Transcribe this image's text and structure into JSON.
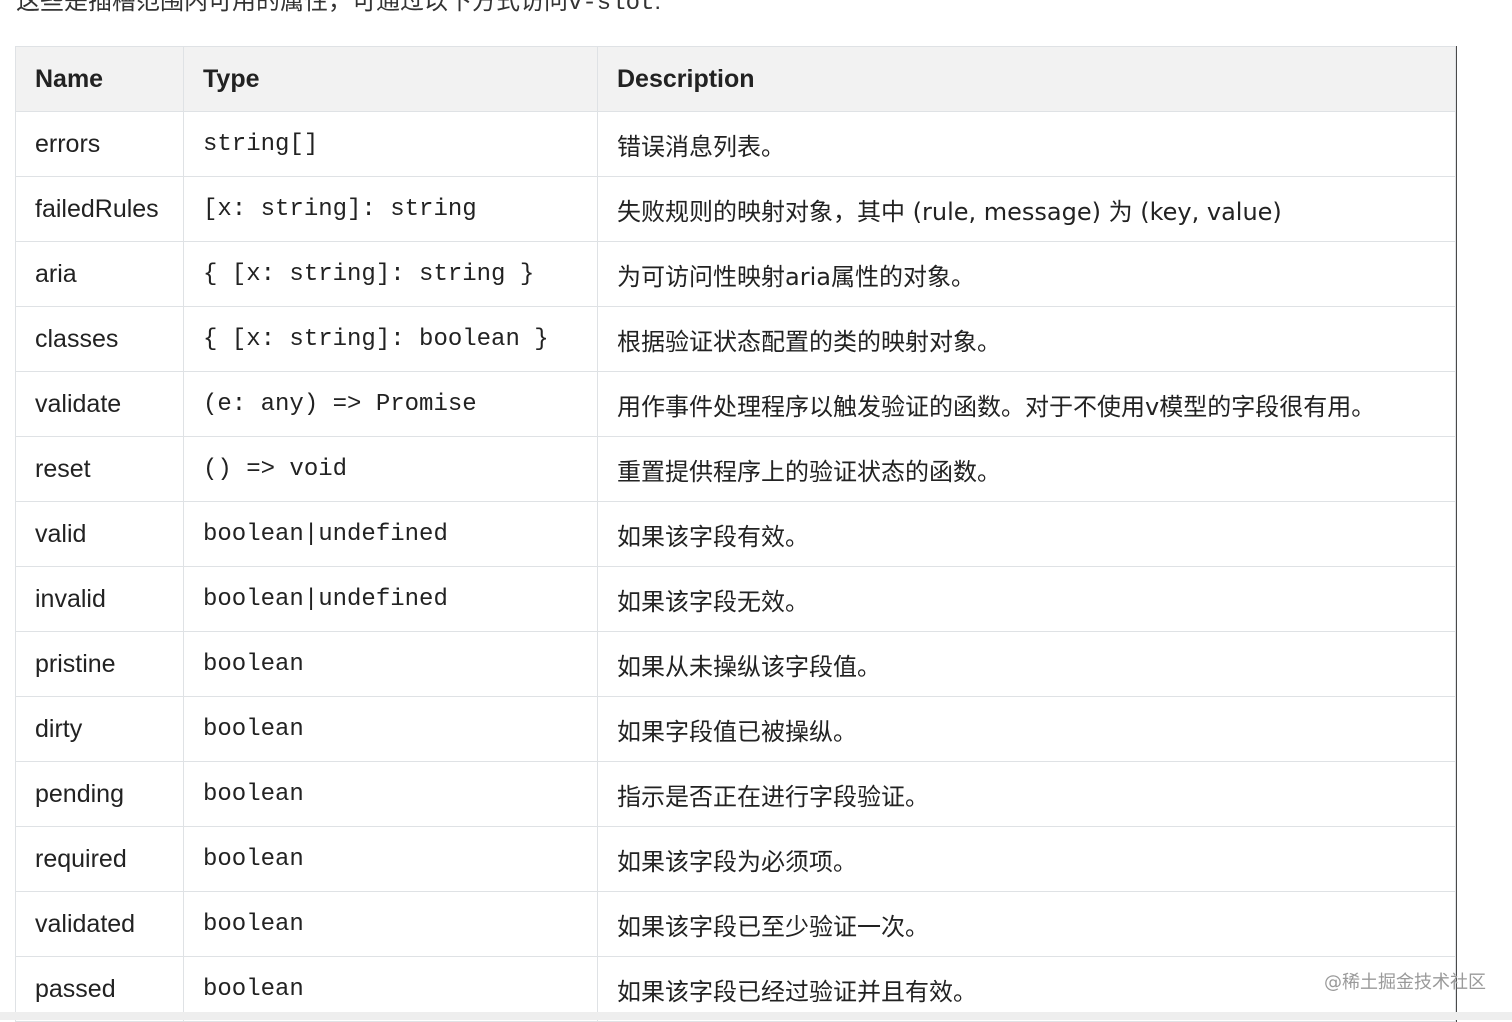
{
  "intro": {
    "text": "这些是插槽范围内可用的属性，可通过以下方式访问",
    "code": "v-slot",
    "suffix": ":"
  },
  "table": {
    "headers": [
      "Name",
      "Type",
      "Description"
    ],
    "rows": [
      {
        "name": "errors",
        "type": "string[]",
        "description": "错误消息列表。"
      },
      {
        "name": "failedRules",
        "type": "[x: string]: string",
        "description": "失败规则的映射对象，其中 (rule, message) 为 (key, value)"
      },
      {
        "name": "aria",
        "type": "{ [x: string]: string }",
        "description": "为可访问性映射aria属性的对象。"
      },
      {
        "name": "classes",
        "type": "{ [x: string]: boolean }",
        "description": "根据验证状态配置的类的映射对象。"
      },
      {
        "name": "validate",
        "type": "(e: any) => Promise",
        "description": "用作事件处理程序以触发验证的函数。对于不使用v模型的字段很有用。"
      },
      {
        "name": "reset",
        "type": "() => void",
        "description": "重置提供程序上的验证状态的函数。"
      },
      {
        "name": "valid",
        "type": "boolean|undefined",
        "description": "如果该字段有效。"
      },
      {
        "name": "invalid",
        "type": "boolean|undefined",
        "description": "如果该字段无效。"
      },
      {
        "name": "pristine",
        "type": "boolean",
        "description": "如果从未操纵该字段值。"
      },
      {
        "name": "dirty",
        "type": "boolean",
        "description": "如果字段值已被操纵。"
      },
      {
        "name": "pending",
        "type": "boolean",
        "description": "指示是否正在进行字段验证。"
      },
      {
        "name": "required",
        "type": "boolean",
        "description": "如果该字段为必须项。"
      },
      {
        "name": "validated",
        "type": "boolean",
        "description": "如果该字段已至少验证一次。"
      },
      {
        "name": "passed",
        "type": "boolean",
        "description": "如果该字段已经过验证并且有效。"
      }
    ]
  },
  "watermark": "@稀土掘金技术社区"
}
